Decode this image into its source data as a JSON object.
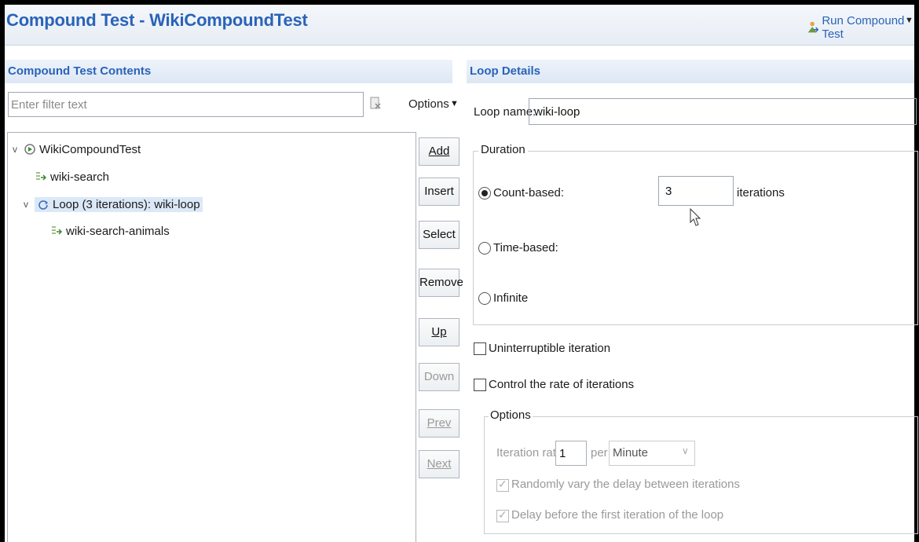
{
  "window": {
    "title": "Compound Test - WikiCompoundTest",
    "run_label": "Run Compound Test"
  },
  "left_panel": {
    "header": "Compound Test Contents",
    "filter_placeholder": "Enter filter text",
    "options_label": "Options",
    "tree": [
      {
        "label": "WikiCompoundTest",
        "icon": "compound-test-icon",
        "expanded": true
      },
      {
        "label": "wiki-search",
        "icon": "test-icon"
      },
      {
        "label": "Loop (3 iterations): wiki-loop",
        "icon": "loop-icon",
        "expanded": true,
        "selected": true
      },
      {
        "label": "wiki-search-animals",
        "icon": "test-icon"
      }
    ],
    "buttons": {
      "add": "Add",
      "insert": "Insert",
      "select": "Select",
      "remove": "Remove",
      "up": "Up",
      "down": "Down",
      "prev": "Prev",
      "next": "Next"
    }
  },
  "right_panel": {
    "header": "Loop Details",
    "loop_name_label": "Loop name:",
    "loop_name_value": "wiki-loop",
    "duration": {
      "legend": "Duration",
      "count_based_label": "Count-based:",
      "count_value": "3",
      "iterations_label": "iterations",
      "time_based_label": "Time-based:",
      "infinite_label": "Infinite",
      "selected": "count-based"
    },
    "uninterruptible_label": "Uninterruptible iteration",
    "control_rate_label": "Control the rate of iterations",
    "options": {
      "legend": "Options",
      "iteration_rate_label": "Iteration rate:",
      "iteration_rate_value": "1",
      "per_label": "per",
      "unit_value": "Minute",
      "random_delay_label": "Randomly vary the delay between iterations",
      "delay_first_label": "Delay before the first iteration of the loop"
    }
  },
  "colors": {
    "accent": "#2a63b8",
    "selection": "#dbe8f8"
  }
}
